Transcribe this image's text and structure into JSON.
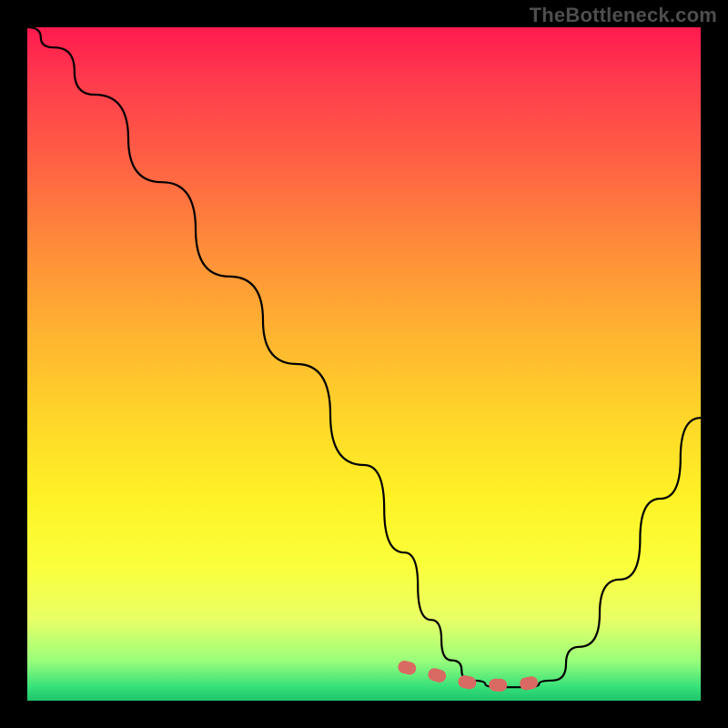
{
  "watermark": "TheBottleneck.com",
  "chart_data": {
    "type": "line",
    "title": "",
    "xlabel": "",
    "ylabel": "",
    "xlim": [
      0,
      100
    ],
    "ylim": [
      0,
      100
    ],
    "series": [
      {
        "name": "bottleneck-curve",
        "x": [
          0,
          4,
          10,
          20,
          30,
          40,
          50,
          56,
          60,
          63,
          66,
          70,
          74,
          78,
          82,
          88,
          94,
          100
        ],
        "values": [
          100,
          97,
          90,
          77,
          63,
          50,
          35,
          22,
          12,
          6,
          3,
          2,
          2,
          3,
          8,
          18,
          30,
          42
        ]
      }
    ],
    "highlight": {
      "name": "optimal-range",
      "x": [
        56,
        60,
        63,
        66,
        70,
        74,
        78
      ],
      "values": [
        5.0,
        4.0,
        3.2,
        2.6,
        2.3,
        2.5,
        3.3
      ]
    },
    "background_gradient": {
      "top": "#ff1a4f",
      "mid": "#ffd629",
      "bottom": "#1fc46a"
    }
  }
}
